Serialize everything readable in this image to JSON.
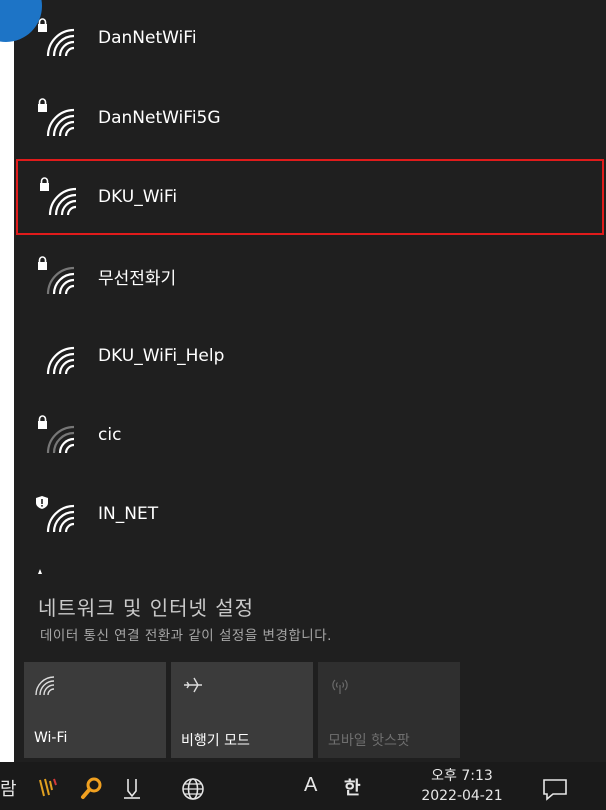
{
  "networks": [
    {
      "name": "DanNetWiFi",
      "secured": true,
      "warning": false
    },
    {
      "name": "DanNetWiFi5G",
      "secured": true,
      "warning": false
    },
    {
      "name": "DKU_WiFi",
      "secured": true,
      "warning": false,
      "selected": true
    },
    {
      "name": "무선전화기",
      "secured": true,
      "warning": false
    },
    {
      "name": "DKU_WiFi_Help",
      "secured": false,
      "warning": false
    },
    {
      "name": "cic",
      "secured": true,
      "warning": false
    },
    {
      "name": "IN_NET",
      "secured": false,
      "warning": true
    }
  ],
  "settings": {
    "title": "네트워크 및 인터넷 설정",
    "subtitle": "데이터 통신 연결 전환과 같이 설정을 변경합니다."
  },
  "tiles": {
    "wifi": {
      "label": "Wi-Fi",
      "icon": "wifi-icon",
      "enabled": true
    },
    "airplane": {
      "label": "비행기 모드",
      "icon": "airplane-icon",
      "enabled": true
    },
    "hotspot": {
      "label": "모바일 핫스팟",
      "icon": "hotspot-icon",
      "enabled": false
    }
  },
  "taskbar": {
    "partial_text": "람",
    "ime_mode": "A",
    "ime_lang": "한",
    "time": "오후 7:13",
    "date": "2022-04-21"
  },
  "colors": {
    "panel_bg": "#1f1f1f",
    "selected_outline": "#e01b1b",
    "tile_bg": "#3b3b3b",
    "accent_circle": "#1d74c6"
  }
}
